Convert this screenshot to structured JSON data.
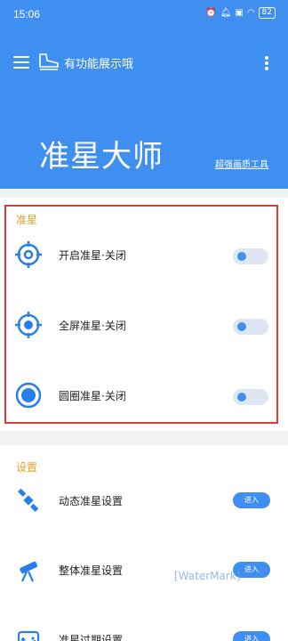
{
  "status_bar": {
    "time": "15:06",
    "battery": "82"
  },
  "toolbar": {
    "app_label": "有功能展示哦"
  },
  "hero": {
    "title": "准星大师",
    "subtitle": "超强画质工具"
  },
  "crosshair_section": {
    "title": "准星",
    "items": [
      {
        "label": "开启准星·关闭",
        "toggle_on": false
      },
      {
        "label": "全屏准星·关闭",
        "toggle_on": false
      },
      {
        "label": "圆圈准星·关闭",
        "toggle_on": false
      }
    ]
  },
  "settings_section": {
    "title": "设置",
    "items": [
      {
        "label": "动态准星设置",
        "button": "进入"
      },
      {
        "label": "整体准星设置",
        "button": "进入"
      },
      {
        "label": "准星过期设置",
        "button": "进入"
      }
    ]
  },
  "watermark": "[WaterMark]",
  "colors": {
    "primary": "#3f8ff0",
    "section_title": "#e0a22c",
    "highlight": "#e23a3a"
  }
}
